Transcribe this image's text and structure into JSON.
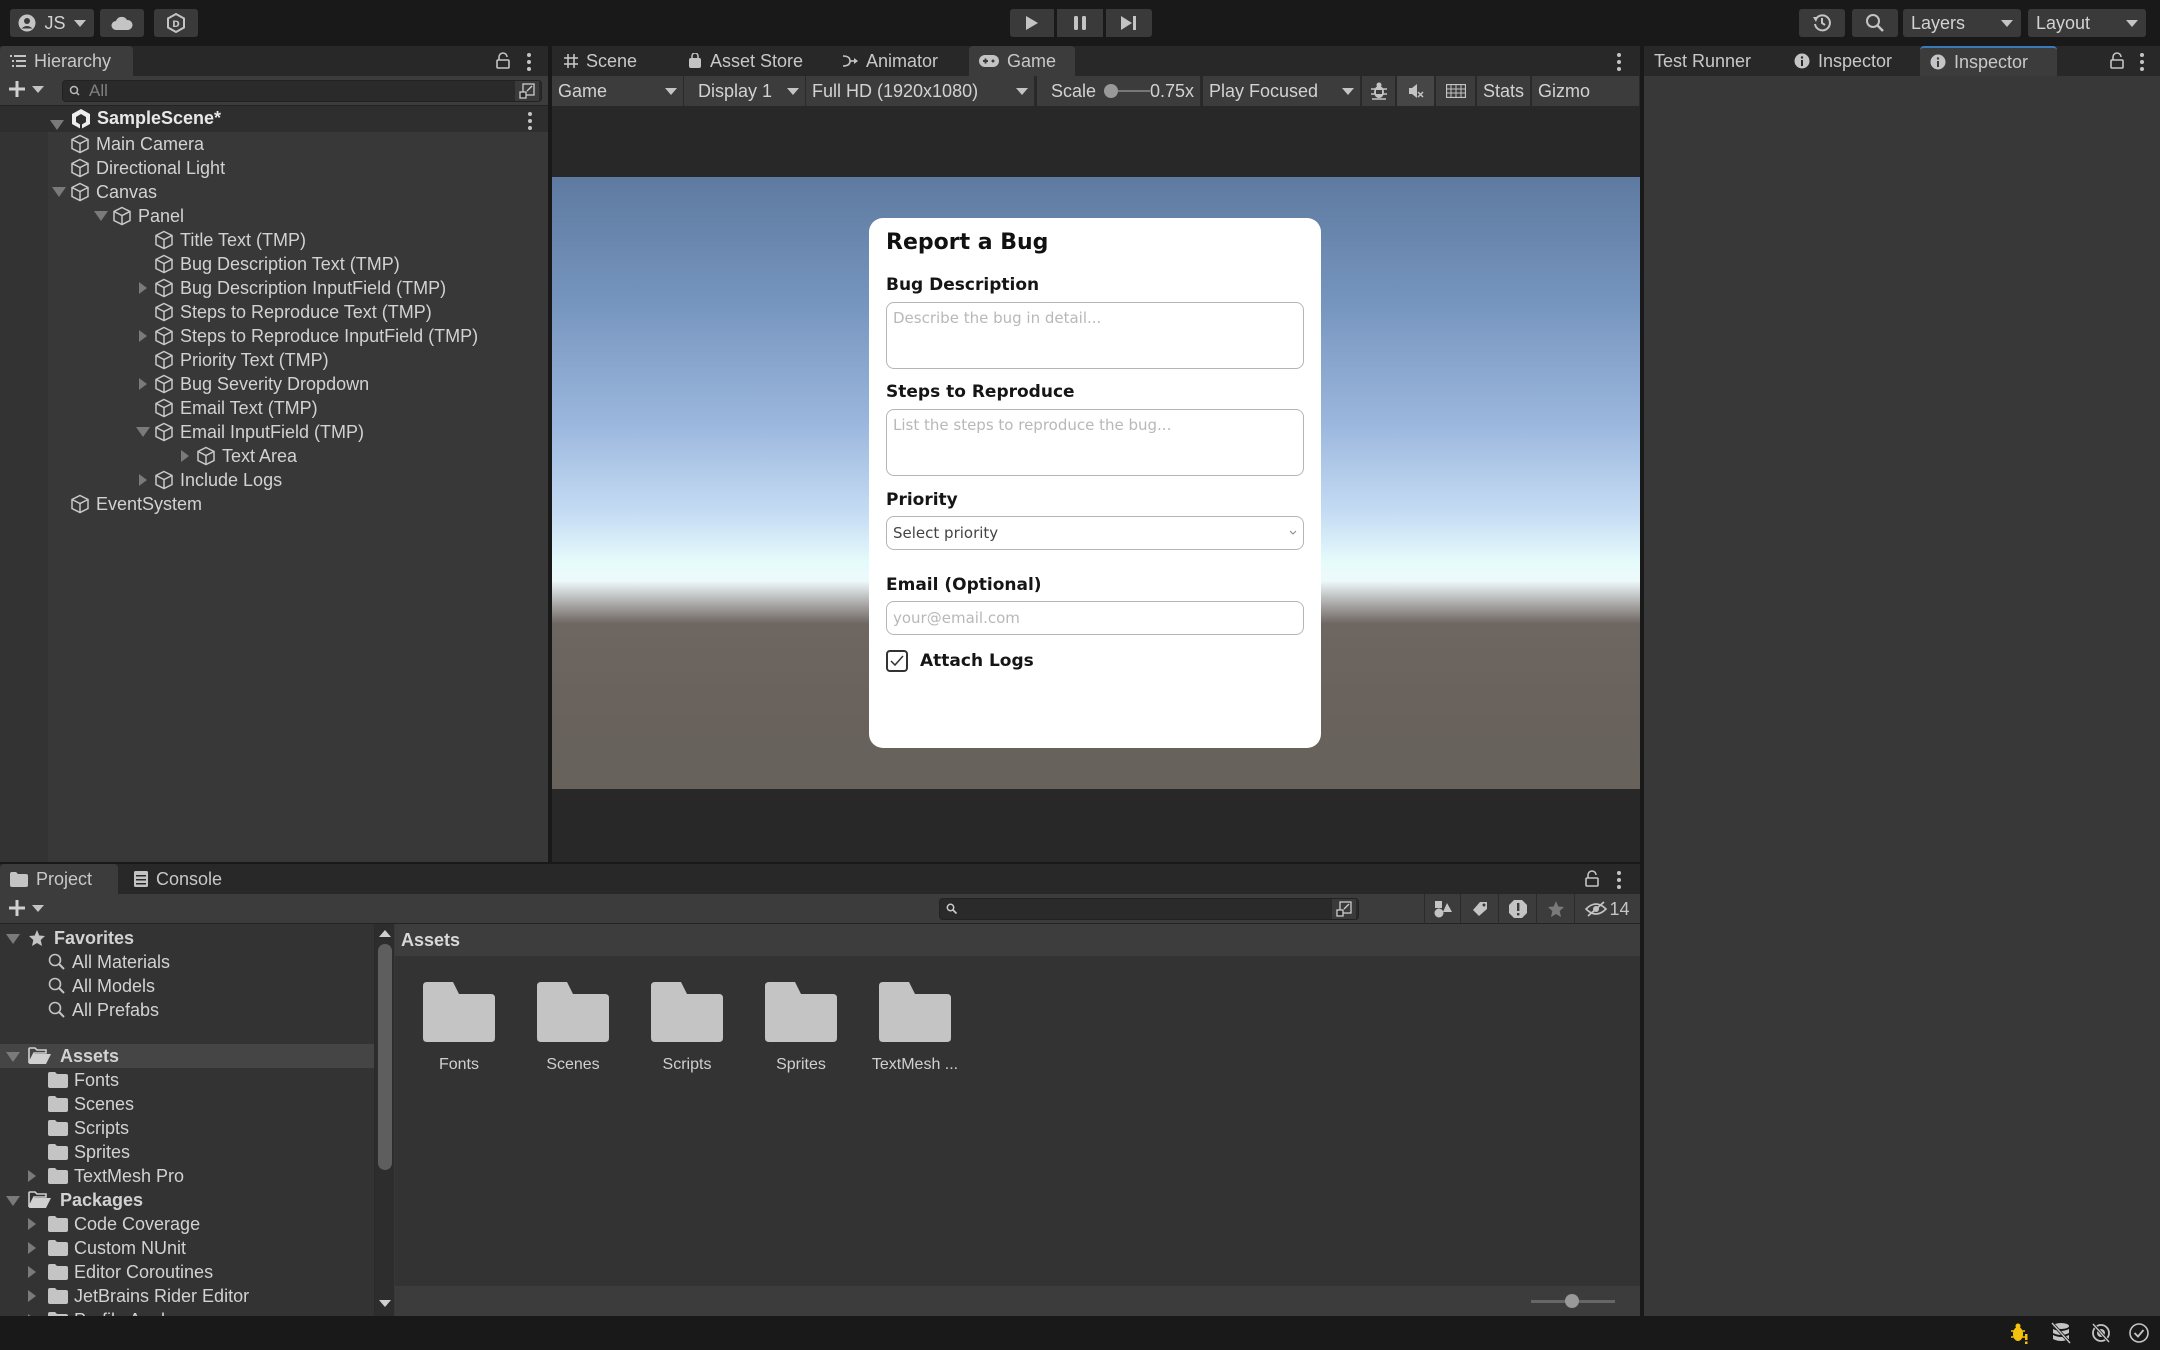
{
  "toolbar": {
    "account_label": "JS",
    "play_icon": "play-icon",
    "pause_icon": "pause-icon",
    "step_icon": "step-icon",
    "layers_label": "Layers",
    "layout_label": "Layout"
  },
  "hierarchy": {
    "tab_label": "Hierarchy",
    "search_placeholder": "All",
    "scene_name": "SampleScene*",
    "items": [
      {
        "label": "Main Camera",
        "depth": 1,
        "arrow": "none"
      },
      {
        "label": "Directional Light",
        "depth": 1,
        "arrow": "none"
      },
      {
        "label": "Canvas",
        "depth": 1,
        "arrow": "expanded"
      },
      {
        "label": "Panel",
        "depth": 2,
        "arrow": "expanded"
      },
      {
        "label": "Title Text (TMP)",
        "depth": 3,
        "arrow": "none"
      },
      {
        "label": "Bug Description Text (TMP)",
        "depth": 3,
        "arrow": "none"
      },
      {
        "label": "Bug Description InputField (TMP)",
        "depth": 3,
        "arrow": "collapsed"
      },
      {
        "label": "Steps to Reproduce Text (TMP)",
        "depth": 3,
        "arrow": "none"
      },
      {
        "label": "Steps to Reproduce InputField (TMP)",
        "depth": 3,
        "arrow": "collapsed"
      },
      {
        "label": "Priority Text (TMP)",
        "depth": 3,
        "arrow": "none"
      },
      {
        "label": "Bug Severity Dropdown",
        "depth": 3,
        "arrow": "collapsed"
      },
      {
        "label": "Email Text (TMP)",
        "depth": 3,
        "arrow": "none"
      },
      {
        "label": "Email InputField (TMP)",
        "depth": 3,
        "arrow": "expanded"
      },
      {
        "label": "Text Area",
        "depth": 4,
        "arrow": "collapsed"
      },
      {
        "label": "Include Logs",
        "depth": 3,
        "arrow": "collapsed"
      },
      {
        "label": "EventSystem",
        "depth": 1,
        "arrow": "none"
      }
    ]
  },
  "center_tabs": [
    {
      "label": "Scene",
      "icon": "grid-icon"
    },
    {
      "label": "Asset Store",
      "icon": "shopping-bag-icon"
    },
    {
      "label": "Animator",
      "icon": "animator-icon"
    },
    {
      "label": "Game",
      "icon": "gamepad-icon"
    }
  ],
  "game_toolbar": {
    "view_mode": "Game",
    "display": "Display 1",
    "resolution": "Full HD (1920x1080)",
    "scale_label": "Scale",
    "scale_value": "0.75x",
    "play_mode": "Play Focused",
    "stats_label": "Stats",
    "gizmos_label": "Gizmo"
  },
  "bug_form": {
    "title": "Report a Bug",
    "description_label": "Bug Description",
    "description_placeholder": "Describe the bug in detail...",
    "steps_label": "Steps to Reproduce",
    "steps_placeholder": "List the steps to reproduce the bug...",
    "priority_label": "Priority",
    "priority_value": "Select priority",
    "email_label": "Email (Optional)",
    "email_placeholder": "your@email.com",
    "attach_logs_label": "Attach Logs",
    "attach_logs_checked": true
  },
  "right_tabs": [
    {
      "label": "Test Runner"
    },
    {
      "label": "Inspector"
    },
    {
      "label": "Inspector"
    }
  ],
  "project": {
    "tabs": [
      {
        "label": "Project",
        "icon": "folder-icon"
      },
      {
        "label": "Console",
        "icon": "console-icon"
      }
    ],
    "hidden_count": "14",
    "favorites_label": "Favorites",
    "favorites": [
      "All Materials",
      "All Models",
      "All Prefabs"
    ],
    "assets_label": "Assets",
    "assets_children": [
      {
        "label": "Fonts",
        "arrow": "none"
      },
      {
        "label": "Scenes",
        "arrow": "none"
      },
      {
        "label": "Scripts",
        "arrow": "none"
      },
      {
        "label": "Sprites",
        "arrow": "none"
      },
      {
        "label": "TextMesh Pro",
        "arrow": "collapsed"
      }
    ],
    "packages_label": "Packages",
    "packages_children": [
      "Code Coverage",
      "Custom NUnit",
      "Editor Coroutines",
      "JetBrains Rider Editor",
      "Profile Analyzer"
    ],
    "breadcrumb": "Assets",
    "grid_items": [
      "Fonts",
      "Scenes",
      "Scripts",
      "Sprites",
      "TextMesh ..."
    ]
  },
  "colors": {
    "accent_blue": "#3a79bb",
    "warning_yellow": "#f4c20d"
  }
}
